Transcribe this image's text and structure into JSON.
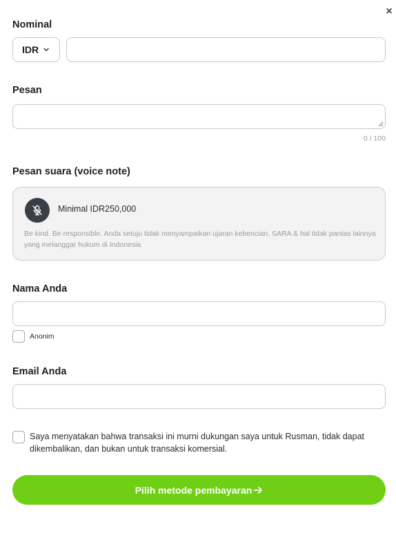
{
  "dialog": {
    "close_glyph": "×"
  },
  "nominal": {
    "label": "Nominal",
    "currency": "IDR",
    "amount_value": "",
    "amount_placeholder": ""
  },
  "message": {
    "label": "Pesan",
    "value": "",
    "counter": "0 / 100"
  },
  "voice_note": {
    "label": "Pesan suara (voice note)",
    "icon": "mic-off-icon",
    "minimum_text": "Minimal IDR250,000",
    "disclaimer": "Be kind. Be responsible. Anda setuju tidak menyampaikan ujaran kebencian, SARA & hal tidak pantas lainnya yang melanggar hukum di Indonesia"
  },
  "name": {
    "label": "Nama Anda",
    "value": "",
    "anonymous_label": "Anonim",
    "anonymous_checked": false
  },
  "email": {
    "label": "Email Anda",
    "value": ""
  },
  "consent": {
    "text": "Saya menyatakan bahwa transaksi ini murni dukungan saya untuk Rusman, tidak dapat dikembalikan, dan bukan untuk transaksi komersial.",
    "checked": false
  },
  "submit": {
    "label": "Pilih metode pembayaran",
    "icon": "arrow-right-icon"
  },
  "colors": {
    "primary_button": "#6fcf14",
    "voice_card_bg": "#f3f3f3",
    "mic_button_bg": "#3a3f47"
  }
}
